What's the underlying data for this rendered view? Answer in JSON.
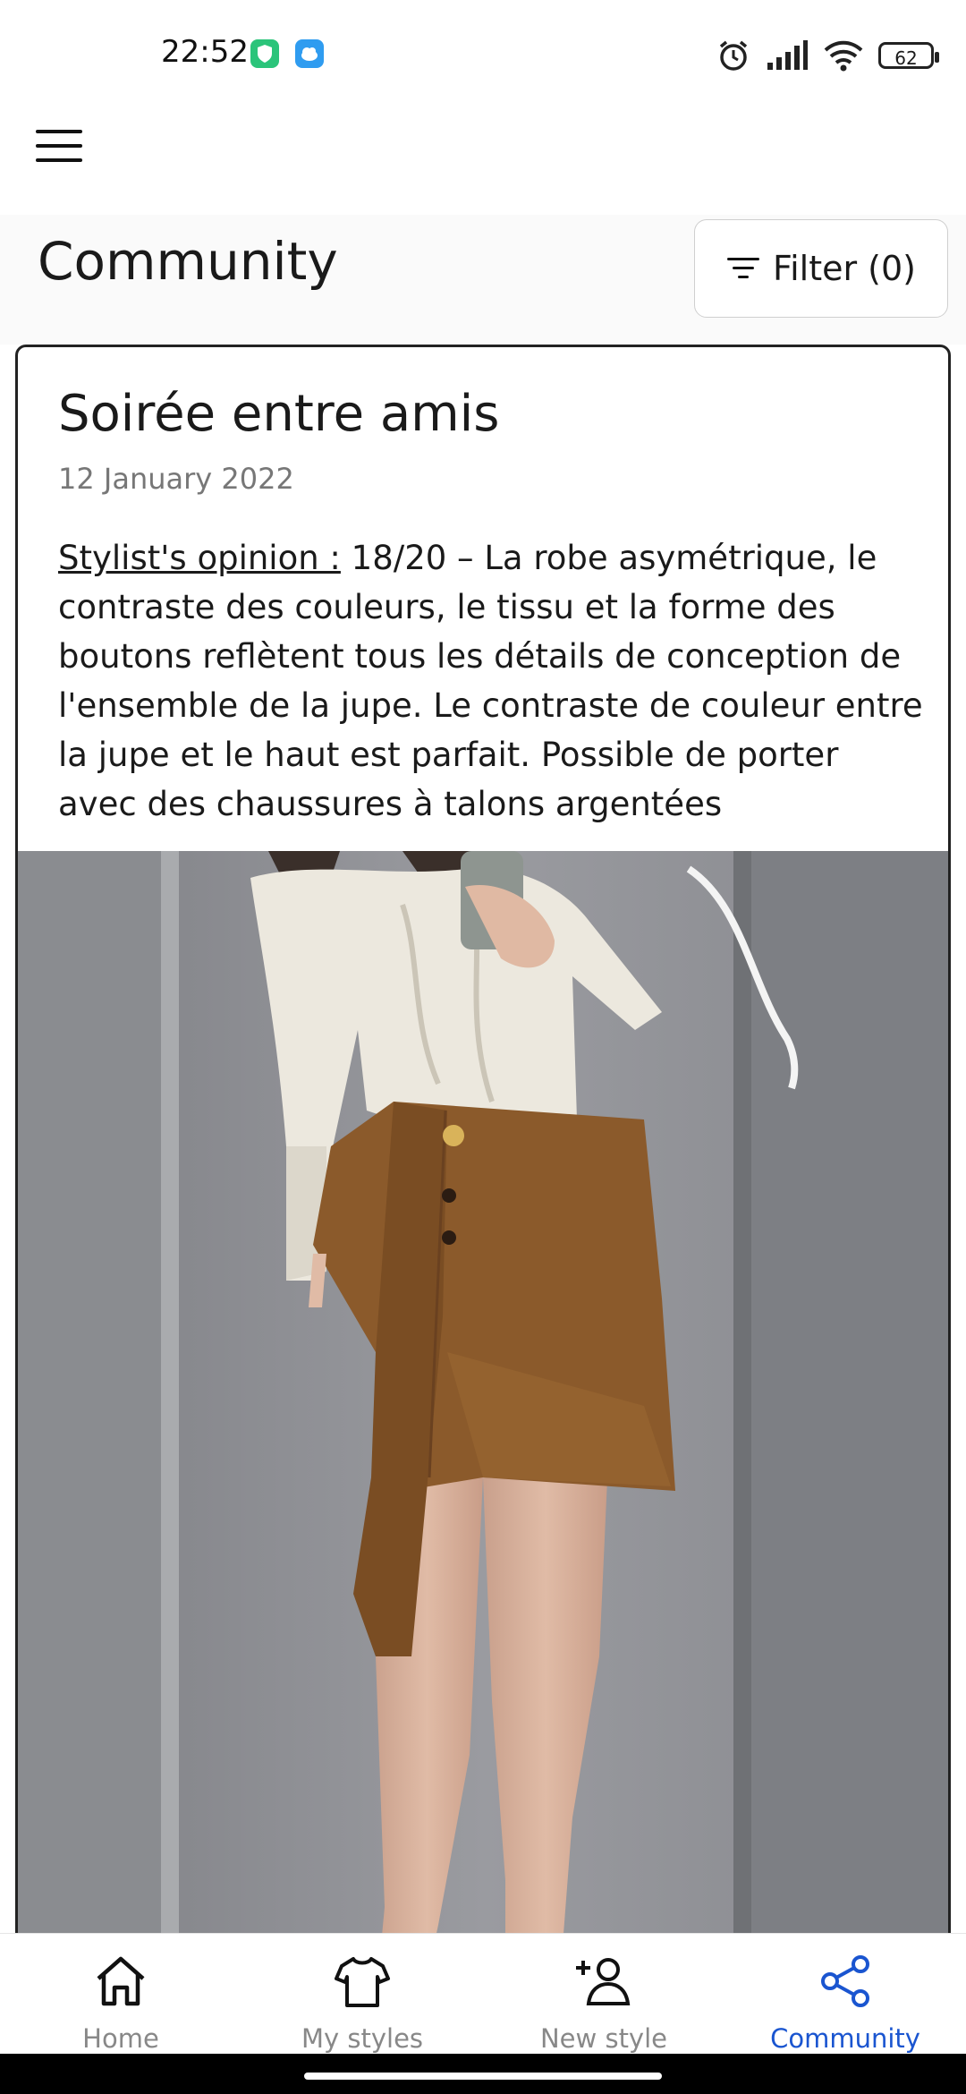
{
  "status_bar": {
    "time": "22:52",
    "battery": "62",
    "icons": [
      "shield-app-icon",
      "cloud-app-icon",
      "alarm-icon",
      "signal-icon",
      "wifi-icon",
      "battery-icon"
    ]
  },
  "header": {
    "menu_icon": "hamburger-icon",
    "title": "Community",
    "filter_label": "Filter (0)"
  },
  "post": {
    "title": "Soirée entre amis",
    "date": "12 January 2022",
    "opinion_label": "Stylist's opinion :",
    "opinion_text": " 18/20 – La robe asymétrique, le contraste des couleurs, le tissu et la forme des boutons reflètent tous les détails de conception de l'ensemble de la jupe. Le contraste de couleur entre la jupe et le haut est parfait. Possible de porter avec des chaussures à talons argentées"
  },
  "nav": {
    "items": [
      {
        "label": "Home",
        "icon": "home-icon"
      },
      {
        "label": "My styles",
        "icon": "tshirt-icon"
      },
      {
        "label": "New style",
        "icon": "add-person-icon"
      },
      {
        "label": "Community",
        "icon": "share-icon"
      }
    ],
    "active": "Community"
  },
  "colors": {
    "accent": "#1a55d0",
    "skirt": "#8b5a2b",
    "blouse": "#ece8de",
    "wall": "#8f9095"
  }
}
